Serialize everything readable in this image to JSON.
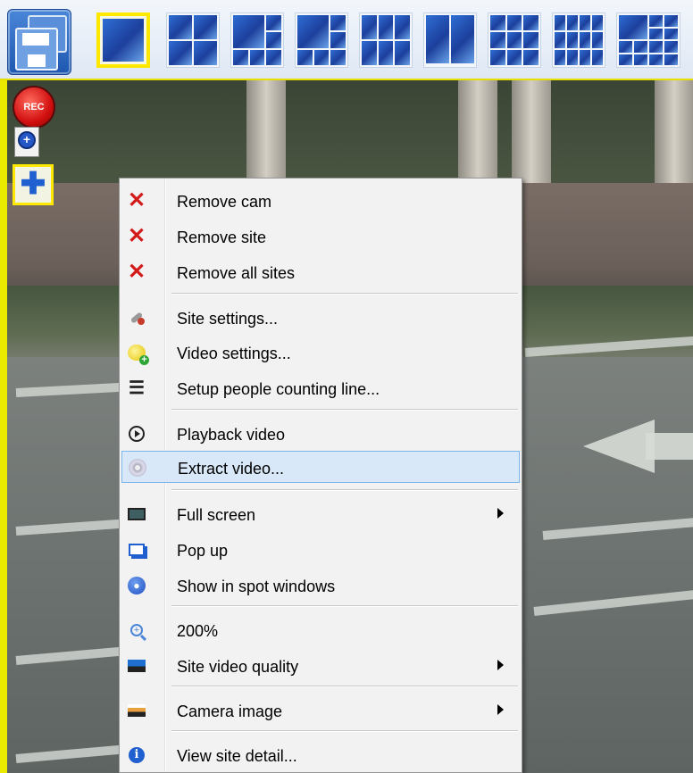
{
  "toolbar": {
    "save_icon": "save-icon",
    "layouts": [
      {
        "id": "1x1",
        "selected": true
      },
      {
        "id": "2x2",
        "selected": false
      },
      {
        "id": "1plus3",
        "selected": false
      },
      {
        "id": "1plus5",
        "selected": false
      },
      {
        "id": "3x2",
        "selected": false
      },
      {
        "id": "2plus6",
        "selected": false
      },
      {
        "id": "3x3",
        "selected": false
      },
      {
        "id": "4x3",
        "selected": false
      },
      {
        "id": "1plus12",
        "selected": false
      }
    ]
  },
  "side_tools": {
    "rec_label": "REC"
  },
  "menu": {
    "items": [
      {
        "label": "Remove cam",
        "icon": "remove-icon",
        "submenu": false
      },
      {
        "label": "Remove site",
        "icon": "remove-icon",
        "submenu": false
      },
      {
        "label": "Remove all sites",
        "icon": "remove-icon",
        "submenu": false
      },
      {
        "label": "Site settings...",
        "icon": "wrench-icon",
        "submenu": false
      },
      {
        "label": "Video settings...",
        "icon": "camera-add-icon",
        "submenu": false
      },
      {
        "label": "Setup people counting line...",
        "icon": "list-icon",
        "submenu": false
      },
      {
        "label": "Playback video",
        "icon": "play-icon",
        "submenu": false
      },
      {
        "label": "Extract video...",
        "icon": "disc-icon",
        "submenu": false,
        "highlighted": true
      },
      {
        "label": "Full screen",
        "icon": "film-icon",
        "submenu": true
      },
      {
        "label": "Pop up",
        "icon": "popup-icon",
        "submenu": false
      },
      {
        "label": "Show in spot windows",
        "icon": "spot-icon",
        "submenu": false
      },
      {
        "label": "200%",
        "icon": "zoom-icon",
        "submenu": false
      },
      {
        "label": "Site video quality",
        "icon": "quality-icon",
        "submenu": true
      },
      {
        "label": "Camera image",
        "icon": "camera-image-icon",
        "submenu": true
      },
      {
        "label": "View site detail...",
        "icon": "info-icon",
        "submenu": false
      }
    ]
  },
  "colors": {
    "selection_border": "#ffe800",
    "menu_highlight": "#d8e8f8",
    "remove_red": "#d21a1a"
  }
}
